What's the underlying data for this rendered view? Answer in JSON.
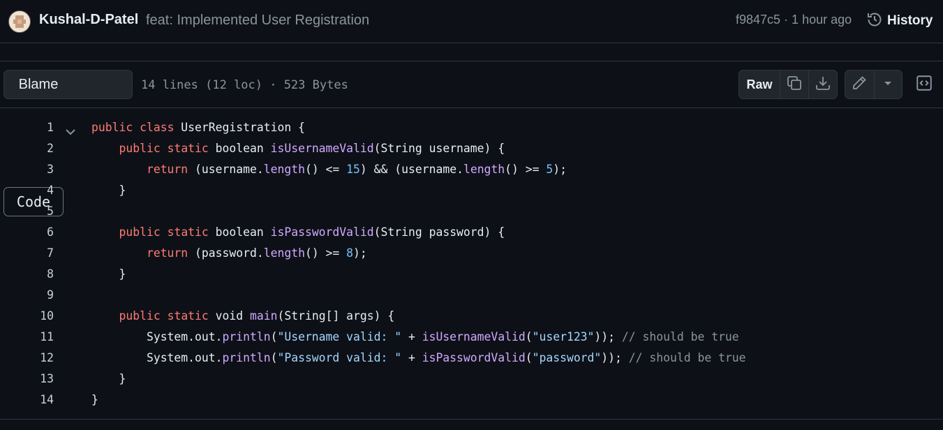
{
  "commit": {
    "author": "Kushal-D-Patel",
    "message": "feat: Implemented User Registration",
    "meta": "f9847c5 · 1 hour ago",
    "history_label": "History"
  },
  "toolbar": {
    "code_tab": "Code",
    "blame_tab": "Blame",
    "file_info": "14 lines (12 loc) · 523 Bytes",
    "raw_label": "Raw"
  },
  "code_lines": [
    {
      "n": "1",
      "indent": "",
      "tokens": [
        [
          "kw",
          "public"
        ],
        [
          "",
          "",
          " "
        ],
        [
          "kw",
          "class"
        ],
        [
          "",
          " UserRegistration {"
        ]
      ]
    },
    {
      "n": "2",
      "indent": "    ",
      "tokens": [
        [
          "kw",
          "public"
        ],
        [
          "",
          " "
        ],
        [
          "kw",
          "static"
        ],
        [
          "",
          " boolean "
        ],
        [
          "fn",
          "isUsernameValid"
        ],
        [
          "",
          "(String username) {"
        ]
      ]
    },
    {
      "n": "3",
      "indent": "        ",
      "tokens": [
        [
          "kw",
          "return"
        ],
        [
          "",
          " (username."
        ],
        [
          "fn",
          "length"
        ],
        [
          "",
          "() <= "
        ],
        [
          "num",
          "15"
        ],
        [
          "",
          ") && (username."
        ],
        [
          "fn",
          "length"
        ],
        [
          "",
          "() >= "
        ],
        [
          "num",
          "5"
        ],
        [
          "",
          ");"
        ]
      ]
    },
    {
      "n": "4",
      "indent": "    ",
      "tokens": [
        [
          "",
          "}"
        ]
      ]
    },
    {
      "n": "5",
      "indent": "",
      "tokens": []
    },
    {
      "n": "6",
      "indent": "    ",
      "tokens": [
        [
          "kw",
          "public"
        ],
        [
          "",
          " "
        ],
        [
          "kw",
          "static"
        ],
        [
          "",
          " boolean "
        ],
        [
          "fn",
          "isPasswordValid"
        ],
        [
          "",
          "(String password) {"
        ]
      ]
    },
    {
      "n": "7",
      "indent": "        ",
      "tokens": [
        [
          "kw",
          "return"
        ],
        [
          "",
          " (password."
        ],
        [
          "fn",
          "length"
        ],
        [
          "",
          "() >= "
        ],
        [
          "num",
          "8"
        ],
        [
          "",
          ");"
        ]
      ]
    },
    {
      "n": "8",
      "indent": "    ",
      "tokens": [
        [
          "",
          "}"
        ]
      ]
    },
    {
      "n": "9",
      "indent": "",
      "tokens": []
    },
    {
      "n": "10",
      "indent": "    ",
      "tokens": [
        [
          "kw",
          "public"
        ],
        [
          "",
          " "
        ],
        [
          "kw",
          "static"
        ],
        [
          "",
          " void "
        ],
        [
          "fn",
          "main"
        ],
        [
          "",
          "(String[] args) {"
        ]
      ]
    },
    {
      "n": "11",
      "indent": "        ",
      "tokens": [
        [
          "",
          "System.out."
        ],
        [
          "fn",
          "println"
        ],
        [
          "",
          "("
        ],
        [
          "str",
          "\"Username valid: \""
        ],
        [
          "",
          " + "
        ],
        [
          "fn",
          "isUsernameValid"
        ],
        [
          "",
          "("
        ],
        [
          "str",
          "\"user123\""
        ],
        [
          "",
          "));"
        ],
        [
          "",
          " "
        ],
        [
          "cm",
          "// should be true"
        ]
      ]
    },
    {
      "n": "12",
      "indent": "        ",
      "tokens": [
        [
          "",
          "System.out."
        ],
        [
          "fn",
          "println"
        ],
        [
          "",
          "("
        ],
        [
          "str",
          "\"Password valid: \""
        ],
        [
          "",
          " + "
        ],
        [
          "fn",
          "isPasswordValid"
        ],
        [
          "",
          "("
        ],
        [
          "str",
          "\"password\""
        ],
        [
          "",
          "));"
        ],
        [
          "",
          " "
        ],
        [
          "cm",
          "// should be true"
        ]
      ]
    },
    {
      "n": "13",
      "indent": "    ",
      "tokens": [
        [
          "",
          "}"
        ]
      ]
    },
    {
      "n": "14",
      "indent": "",
      "tokens": [
        [
          "",
          "}"
        ]
      ]
    }
  ]
}
